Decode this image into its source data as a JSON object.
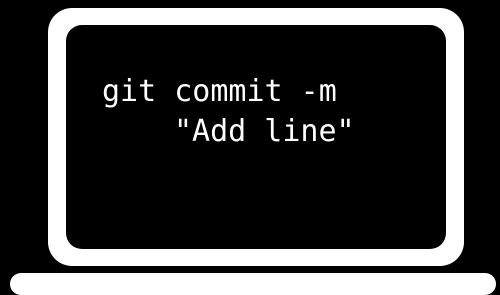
{
  "terminal": {
    "command_line_1": "git commit -m",
    "command_line_2": "\"Add line\""
  },
  "colors": {
    "background": "#000000",
    "laptop_body": "#ffffff",
    "screen": "#000000",
    "text": "#ffffff"
  },
  "icons": {
    "device": "laptop-icon"
  }
}
